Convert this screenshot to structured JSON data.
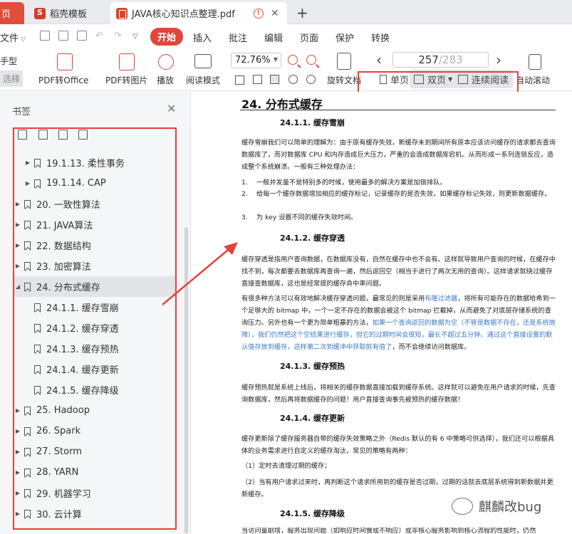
{
  "tabs": {
    "home": "页",
    "templates": "稻壳模板",
    "document": "JAVA核心知识点整理.pdf",
    "new_tab": "+",
    "close": "✕"
  },
  "menu": {
    "file": "文件",
    "items": [
      "开始",
      "插入",
      "批注",
      "编辑",
      "页面",
      "保护",
      "转换"
    ]
  },
  "ribbon": {
    "hand_tool": "手型",
    "select_tool": "选择",
    "pdf_to_office": "PDF转Office",
    "pdf_to_image": "PDF转图片",
    "play": "播放",
    "read_mode": "阅读模式",
    "zoom": "72.76%",
    "rotate_doc": "旋转文档",
    "page_current": "257",
    "page_total": "/283",
    "single_page": "单页",
    "double_page": "双页",
    "continuous": "连续阅读",
    "auto_scroll": "自动滚动"
  },
  "sidebar": {
    "title": "书签",
    "items": [
      {
        "label": "19.1.13. 柔性事务",
        "level": 1,
        "arrow": "▶"
      },
      {
        "label": "19.1.14. CAP",
        "level": 1,
        "arrow": "▶"
      },
      {
        "label": "20. 一致性算法",
        "level": 0,
        "arrow": "▶"
      },
      {
        "label": "21. JAVA算法",
        "level": 0,
        "arrow": "▶"
      },
      {
        "label": "22. 数据结构",
        "level": 0,
        "arrow": "▶"
      },
      {
        "label": "23. 加密算法",
        "level": 0,
        "arrow": "▶"
      },
      {
        "label": "24. 分布式缓存",
        "level": 0,
        "arrow": "◢"
      },
      {
        "label": "24.1.1. 缓存雪崩",
        "level": 1,
        "arrow": ""
      },
      {
        "label": "24.1.2. 缓存穿透",
        "level": 1,
        "arrow": ""
      },
      {
        "label": "24.1.3. 缓存预热",
        "level": 1,
        "arrow": ""
      },
      {
        "label": "24.1.4. 缓存更新",
        "level": 1,
        "arrow": ""
      },
      {
        "label": "24.1.5. 缓存降级",
        "level": 1,
        "arrow": ""
      },
      {
        "label": "25. Hadoop",
        "level": 0,
        "arrow": "▶"
      },
      {
        "label": "26. Spark",
        "level": 0,
        "arrow": "▶"
      },
      {
        "label": "27. Storm",
        "level": 0,
        "arrow": "▶"
      },
      {
        "label": "28. YARN",
        "level": 0,
        "arrow": "▶"
      },
      {
        "label": "29. 机器学习",
        "level": 0,
        "arrow": "▶"
      },
      {
        "label": "30. 云计算",
        "level": 0,
        "arrow": "▶"
      }
    ]
  },
  "doc": {
    "h1": "24.  分布式缓存",
    "s1_title": "24.1.1.    缓存雪崩",
    "s1_p1": "缓存雪崩我们可以简单的理解为：由于原有缓存失效，新缓存未到期间所有原本应该访问缓存的请求都去查询数据库了，而对数据库 CPU 和内存造成巨大压力，严重的会造成数据库宕机。从而形成一系列连锁反应，造成整个系统崩溃。一般有三种处理办法：",
    "s1_li1": "一般并发量不是特别多的时候，使用最多的解决方案是加锁排队。",
    "s1_li2": "给每一个缓存数据增加相应的缓存标记，记录缓存的是否失效，如果缓存标记失效，则更新数据缓存。",
    "s1_li3": "为 key 设置不同的缓存失效时间。",
    "s2_title": "24.1.2.    缓存穿透",
    "s2_p1": "缓存穿透是指用户查询数据，在数据库没有，自然在缓存中也不会有。这样就导致用户查询的时候，在缓存中找不到，每次都要去数据库再查询一遍，然后返回空（相当于进行了两次无用的查询）。这样请求就绕过缓存直接查数据库，这也是经常提的缓存命中率问题。",
    "s2_p2a": "有很多种方法可以有效地解决缓存穿透问题，最常见的则是采用",
    "s2_p2b": "布隆过滤器",
    "s2_p2c": "，将所有可能存在的数据哈希到一个足够大的 bitmap 中，一个一定不存在的数据会被这个 bitmap 拦截掉，从而避免了对底层存储系统的查询压力。另外也有一个更为简单粗暴的方法，",
    "s2_p2d": "如果一个查询返回的数据为空（不管是数据不存在，还是系统故障），我们仍然把这个空结果进行缓存，但它的过期时间会很短，最长不超过五分钟。通过这个直接设置的默认值存放到缓存，这样第二次到缓冲中获取就有值了",
    "s2_p2e": "，而不会继续访问数据库。",
    "s3_title": "24.1.3.    缓存预热",
    "s3_p1": "缓存预热就是系统上线后，将相关的缓存数据直接加载到缓存系统。这样就可以避免在用户请求的时候，先查询数据库，然后再将数据缓存的问题！用户直接查询事先被预热的缓存数据！",
    "s4_title": "24.1.4.    缓存更新",
    "s4_p1": "缓存更新除了缓存服务器自带的缓存失效策略之外（Redis 默认的有 6 中策略可供选择），我们还可以根据具体的业务需求进行自定义的缓存淘汰，常见的策略有两种：",
    "s4_li1": "（1）定时去清理过期的缓存；",
    "s4_li2": "（2）当有用户请求过来时，再判断这个请求所用到的缓存是否过期，过期的话就去底层系统得到新数据并更新缓存。",
    "s5_title": "24.1.5.    缓存降级",
    "s5_p1": "当访问量剧增，服务出现问题（如响应时间慢或不响应）或非核心服务影响到核心流程的性能时，仍然"
  },
  "watermark": "麒麟改bug",
  "colors": {
    "accent": "#e0463c",
    "highlight": "#e5413c",
    "link": "#3c78c4"
  }
}
